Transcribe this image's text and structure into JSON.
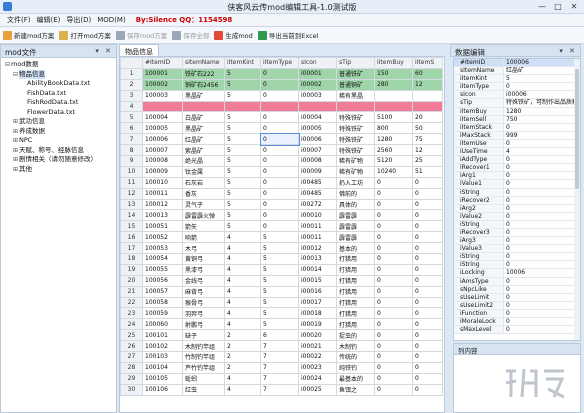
{
  "window": {
    "title": "侠客风云传mod编辑工具-1.0测试版",
    "min": "—",
    "max": "□",
    "close": "✕"
  },
  "menu": {
    "items": [
      "文件(F)",
      "编辑(E)",
      "导出(D)",
      "MOD(M)"
    ],
    "author": "By:Silence  QQ：1154598"
  },
  "toolbar": {
    "items": [
      {
        "label": "新建mod方案",
        "icon": "new-icon",
        "color": "#e8a13a",
        "enabled": true
      },
      {
        "label": "打开mod方案",
        "icon": "open-icon",
        "color": "#d9b24a",
        "enabled": true
      },
      {
        "label": "保存mod方案",
        "icon": "save-icon",
        "color": "#9aa7b8",
        "enabled": false
      },
      {
        "label": "保存全部",
        "icon": "save-all-icon",
        "color": "#9aa7b8",
        "enabled": false
      },
      {
        "label": "生成mod",
        "icon": "build-icon",
        "color": "#e04a3a",
        "enabled": true
      },
      {
        "label": "导出当前到Excel",
        "icon": "excel-icon",
        "color": "#2f9a4d",
        "enabled": true
      }
    ]
  },
  "left_panel": {
    "title": "mod文件",
    "tree": [
      {
        "label": "mod数据",
        "level": 0,
        "toggle": "⊟"
      },
      {
        "label": "物品信息",
        "level": 1,
        "toggle": "⊟",
        "selected": true
      },
      {
        "label": "AbilityBookData.txt",
        "level": 2,
        "toggle": ""
      },
      {
        "label": "FishData.txt",
        "level": 2,
        "toggle": ""
      },
      {
        "label": "FishRodData.txt",
        "level": 2,
        "toggle": ""
      },
      {
        "label": "FlowerData.txt",
        "level": 2,
        "toggle": ""
      },
      {
        "label": "武功信息",
        "level": 1,
        "toggle": "⊞"
      },
      {
        "label": "养成数据",
        "level": 1,
        "toggle": "⊞"
      },
      {
        "label": "NPC",
        "level": 1,
        "toggle": "⊞"
      },
      {
        "label": "天赋、称号、经脉信息",
        "level": 1,
        "toggle": "⊞"
      },
      {
        "label": "剧情相关（请勿随意修改）",
        "level": 1,
        "toggle": "⊞"
      },
      {
        "label": "其他",
        "level": 1,
        "toggle": "⊞"
      }
    ]
  },
  "center": {
    "tab": "物品信息",
    "columns": [
      "#ItemID",
      "sItemName",
      "iItemKint",
      "iItemType",
      "sIcon",
      "sTip",
      "iItemBuy",
      "iItemS"
    ],
    "rows": [
      {
        "n": "1",
        "style": "green",
        "cells": [
          "100001",
          "铁矿石222",
          "5",
          "0",
          "i00001",
          "普通铁矿",
          "150",
          "60"
        ]
      },
      {
        "n": "2",
        "style": "green",
        "cells": [
          "100002",
          "铜矿石2456",
          "5",
          "0",
          "i00002",
          "普通铜矿",
          "280",
          "12"
        ]
      },
      {
        "n": "3",
        "style": "",
        "cells": [
          "100003",
          "黑晶矿",
          "5",
          "0",
          "i00003",
          "稀有黑晶",
          "",
          ""
        ]
      },
      {
        "n": "4",
        "style": "pink",
        "cells": [
          "",
          "",
          "",
          "",
          "",
          "",
          "",
          ""
        ]
      },
      {
        "n": "5",
        "style": "",
        "cells": [
          "100004",
          "白晶矿",
          "5",
          "0",
          "i00004",
          "特殊铁矿",
          "5100",
          "20"
        ]
      },
      {
        "n": "6",
        "style": "",
        "cells": [
          "100005",
          "黑晶矿",
          "5",
          "0",
          "i00005",
          "特殊铁矿",
          "800",
          "50"
        ]
      },
      {
        "n": "7",
        "style": "",
        "cells": [
          "100006",
          "红晶矿",
          "5",
          "0",
          "i00006",
          "特殊铁矿",
          "1280",
          "75"
        ]
      },
      {
        "n": "8",
        "style": "",
        "cells": [
          "100007",
          "紫晶矿",
          "5",
          "0",
          "i00007",
          "特殊铁矿",
          "2560",
          "12"
        ]
      },
      {
        "n": "9",
        "style": "",
        "cells": [
          "100008",
          "绝光晶",
          "5",
          "0",
          "i00008",
          "稀有矿物",
          "5120",
          "25"
        ]
      },
      {
        "n": "10",
        "style": "",
        "cells": [
          "100009",
          "钛金属",
          "5",
          "0",
          "i00009",
          "稀有矿物",
          "10240",
          "51"
        ]
      },
      {
        "n": "11",
        "style": "",
        "cells": [
          "100010",
          "石灰岩",
          "5",
          "0",
          "i00485",
          "扔入工坊",
          "0",
          "0"
        ]
      },
      {
        "n": "12",
        "style": "",
        "cells": [
          "100011",
          "香灰",
          "5",
          "0",
          "i00485",
          "佛前的",
          "0",
          "0"
        ]
      },
      {
        "n": "13",
        "style": "",
        "cells": [
          "100012",
          "灵气子",
          "5",
          "0",
          "i00272",
          "具体的",
          "0",
          "0"
        ]
      },
      {
        "n": "14",
        "style": "",
        "cells": [
          "100013",
          "霹雷霹火弹",
          "5",
          "0",
          "i00010",
          "霹雷霹",
          "0",
          "0"
        ]
      },
      {
        "n": "15",
        "style": "",
        "cells": [
          "100051",
          "箭矢",
          "5",
          "0",
          "i00011",
          "霹雷霹",
          "0",
          "0"
        ]
      },
      {
        "n": "16",
        "style": "",
        "cells": [
          "100052",
          "响箭",
          "4",
          "5",
          "i00011",
          "霹雷霹",
          "0",
          "0"
        ]
      },
      {
        "n": "17",
        "style": "",
        "cells": [
          "100053",
          "木弓",
          "4",
          "5",
          "i00012",
          "基本的",
          "0",
          "0"
        ]
      },
      {
        "n": "18",
        "style": "",
        "cells": [
          "100054",
          "黄铜弓",
          "4",
          "5",
          "i00013",
          "打猎用",
          "0",
          "0"
        ]
      },
      {
        "n": "19",
        "style": "",
        "cells": [
          "100055",
          "黑漆弓",
          "4",
          "5",
          "i00014",
          "打猎用",
          "0",
          "0"
        ]
      },
      {
        "n": "20",
        "style": "",
        "cells": [
          "100056",
          "金线弓",
          "4",
          "5",
          "i00015",
          "打猎用",
          "0",
          "0"
        ]
      },
      {
        "n": "21",
        "style": "",
        "cells": [
          "100057",
          "麻背弓",
          "4",
          "5",
          "i00016",
          "打猎用",
          "0",
          "0"
        ]
      },
      {
        "n": "22",
        "style": "",
        "cells": [
          "100058",
          "猴骨弓",
          "4",
          "5",
          "i00017",
          "打猎用",
          "0",
          "0"
        ]
      },
      {
        "n": "23",
        "style": "",
        "cells": [
          "100059",
          "羽羿弓",
          "4",
          "5",
          "i00018",
          "打猎用",
          "0",
          "0"
        ]
      },
      {
        "n": "24",
        "style": "",
        "cells": [
          "100060",
          "射鹏弓",
          "4",
          "5",
          "i00019",
          "打猎用",
          "0",
          "0"
        ]
      },
      {
        "n": "25",
        "style": "",
        "cells": [
          "100101",
          "缺子",
          "2",
          "6",
          "i00020",
          "捉虫的",
          "0",
          "0"
        ]
      },
      {
        "n": "26",
        "style": "",
        "cells": [
          "100102",
          "木制钓竿组",
          "2",
          "7",
          "i00021",
          "木制钓",
          "0",
          "0"
        ]
      },
      {
        "n": "27",
        "style": "",
        "cells": [
          "100103",
          "竹制钓竿组",
          "2",
          "7",
          "i00022",
          "传统的",
          "0",
          "0"
        ]
      },
      {
        "n": "28",
        "style": "",
        "cells": [
          "100104",
          "芦竹钓竿组",
          "2",
          "7",
          "i00023",
          "纯铁钓",
          "0",
          "0"
        ]
      },
      {
        "n": "29",
        "style": "",
        "cells": [
          "100105",
          "蚯蚓",
          "4",
          "7",
          "i00024",
          "最基本的",
          "0",
          "0"
        ]
      },
      {
        "n": "30",
        "style": "",
        "cells": [
          "100106",
          "红虫",
          "4",
          "7",
          "i00025",
          "鱼饵之",
          "0",
          "0"
        ]
      }
    ],
    "current_row": "7"
  },
  "editor": {
    "title": "数据编辑",
    "fields": [
      {
        "k": "#ItemID",
        "v": "100006",
        "hl": true
      },
      {
        "k": "sItemName",
        "v": "红晶矿"
      },
      {
        "k": "iItemKint",
        "v": "5"
      },
      {
        "k": "iItemType",
        "v": "0"
      },
      {
        "k": "sIcon",
        "v": "i00006"
      },
      {
        "k": "sTip",
        "v": "特殊铁矿，可制作出品质精良的武器"
      },
      {
        "k": "iItemBuy",
        "v": "1280"
      },
      {
        "k": "iItemSell",
        "v": "750"
      },
      {
        "k": "iItemStack",
        "v": "0"
      },
      {
        "k": "iMaxStack",
        "v": "999"
      },
      {
        "k": "iItemUse",
        "v": "0"
      },
      {
        "k": "iUseTime",
        "v": "4"
      },
      {
        "k": "iAddType",
        "v": "0"
      },
      {
        "k": "iRecover1",
        "v": "0"
      },
      {
        "k": "iArg1",
        "v": "0"
      },
      {
        "k": "iValue1",
        "v": "0"
      },
      {
        "k": "iString",
        "v": "0"
      },
      {
        "k": "iRecover2",
        "v": "0"
      },
      {
        "k": "iArg2",
        "v": "0"
      },
      {
        "k": "iValue2",
        "v": "0"
      },
      {
        "k": "iString",
        "v": "0"
      },
      {
        "k": "iRecover3",
        "v": "0"
      },
      {
        "k": "iArg3",
        "v": "0"
      },
      {
        "k": "iValue3",
        "v": "0"
      },
      {
        "k": "iString",
        "v": "0"
      },
      {
        "k": "iString",
        "v": "0"
      },
      {
        "k": "iLocking",
        "v": "10006"
      },
      {
        "k": "iAmsType",
        "v": "0"
      },
      {
        "k": "sNpcLike",
        "v": "0"
      },
      {
        "k": "sUseLimit",
        "v": "0"
      },
      {
        "k": "sUseLimit2",
        "v": "0"
      },
      {
        "k": "iFunction",
        "v": "0"
      },
      {
        "k": "iMoraleLock",
        "v": "0"
      },
      {
        "k": "sMaxLevel",
        "v": "0"
      }
    ]
  },
  "bottom_panel": {
    "title": "列内容"
  },
  "watermark": {
    "text": "游侠网"
  }
}
